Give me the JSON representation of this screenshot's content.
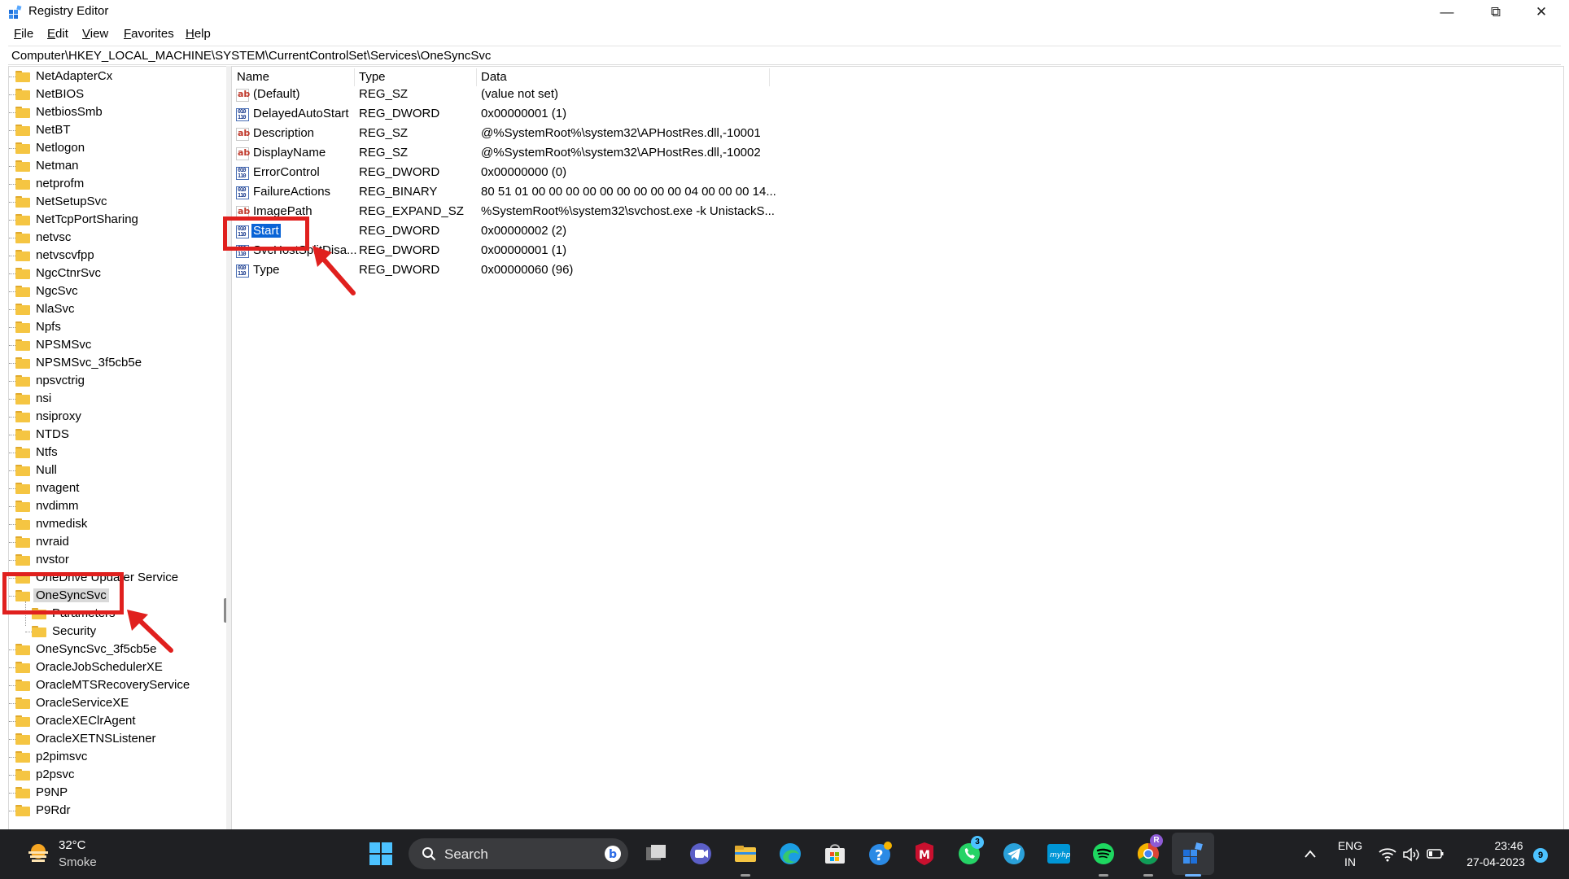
{
  "window": {
    "title": "Registry Editor",
    "controls": {
      "minimize": "—",
      "maximize": "⧉",
      "close": "✕"
    }
  },
  "menu": {
    "items": [
      {
        "underline": "F",
        "rest": "ile"
      },
      {
        "underline": "E",
        "rest": "dit"
      },
      {
        "underline": "V",
        "rest": "iew"
      },
      {
        "underline": "F",
        "rest": "avorites",
        "underline_after": true
      },
      {
        "underline": "H",
        "rest": "elp"
      }
    ]
  },
  "address": "Computer\\HKEY_LOCAL_MACHINE\\SYSTEM\\CurrentControlSet\\Services\\OneSyncSvc",
  "tree": {
    "items": [
      "NetAdapterCx",
      "NetBIOS",
      "NetbiosSmb",
      "NetBT",
      "Netlogon",
      "Netman",
      "netprofm",
      "NetSetupSvc",
      "NetTcpPortSharing",
      "netvsc",
      "netvscvfpp",
      "NgcCtnrSvc",
      "NgcSvc",
      "NlaSvc",
      "Npfs",
      "NPSMSvc",
      "NPSMSvc_3f5cb5e",
      "npsvctrig",
      "nsi",
      "nsiproxy",
      "NTDS",
      "Ntfs",
      "Null",
      "nvagent",
      "nvdimm",
      "nvmedisk",
      "nvraid",
      "nvstor",
      "OneDrive Updater Service",
      "OneSyncSvc",
      "Parameters",
      "Security",
      "OneSyncSvc_3f5cb5e",
      "OracleJobSchedulerXE",
      "OracleMTSRecoveryService",
      "OracleServiceXE",
      "OracleXEClrAgent",
      "OracleXETNSListener",
      "p2pimsvc",
      "p2psvc",
      "P9NP",
      "P9Rdr"
    ],
    "selected": "OneSyncSvc"
  },
  "values": {
    "headers": {
      "name": "Name",
      "type": "Type",
      "data": "Data"
    },
    "rows": [
      {
        "icon": "string-value-icon",
        "name": "(Default)",
        "type": "REG_SZ",
        "data": "(value not set)"
      },
      {
        "icon": "dword-value-icon",
        "name": "DelayedAutoStart",
        "type": "REG_DWORD",
        "data": "0x00000001 (1)"
      },
      {
        "icon": "string-value-icon",
        "name": "Description",
        "type": "REG_SZ",
        "data": "@%SystemRoot%\\system32\\APHostRes.dll,-10001"
      },
      {
        "icon": "string-value-icon",
        "name": "DisplayName",
        "type": "REG_SZ",
        "data": "@%SystemRoot%\\system32\\APHostRes.dll,-10002"
      },
      {
        "icon": "dword-value-icon",
        "name": "ErrorControl",
        "type": "REG_DWORD",
        "data": "0x00000000 (0)"
      },
      {
        "icon": "binary-value-icon",
        "name": "FailureActions",
        "type": "REG_BINARY",
        "data": "80 51 01 00 00 00 00 00 00 00 00 00 04 00 00 00 14..."
      },
      {
        "icon": "string-value-icon",
        "name": "ImagePath",
        "type": "REG_EXPAND_SZ",
        "data": "%SystemRoot%\\system32\\svchost.exe -k UnistackS..."
      },
      {
        "icon": "dword-value-icon",
        "name": "Start",
        "type": "REG_DWORD",
        "data": "0x00000002 (2)"
      },
      {
        "icon": "dword-value-icon",
        "name": "SvcHostSplitDisa...",
        "type": "REG_DWORD",
        "data": "0x00000001 (1)"
      },
      {
        "icon": "dword-value-icon",
        "name": "Type",
        "type": "REG_DWORD",
        "data": "0x00000060 (96)"
      }
    ],
    "selected": "Start"
  },
  "annotations": {
    "color": "#e0201e"
  },
  "taskbar": {
    "weather": {
      "temp": "32°C",
      "desc": "Smoke"
    },
    "search_label": "Search",
    "badges": {
      "whatsapp": "3",
      "chrome": "R",
      "notifications": "9"
    },
    "lang_top": "ENG",
    "lang_bottom": "IN",
    "time": "23:46",
    "date": "27-04-2023"
  },
  "colors": {
    "selection": "#0a64d6",
    "tree_selection": "#d9d9d9",
    "taskbar": "#1f2023",
    "folder": "#f5c542"
  }
}
